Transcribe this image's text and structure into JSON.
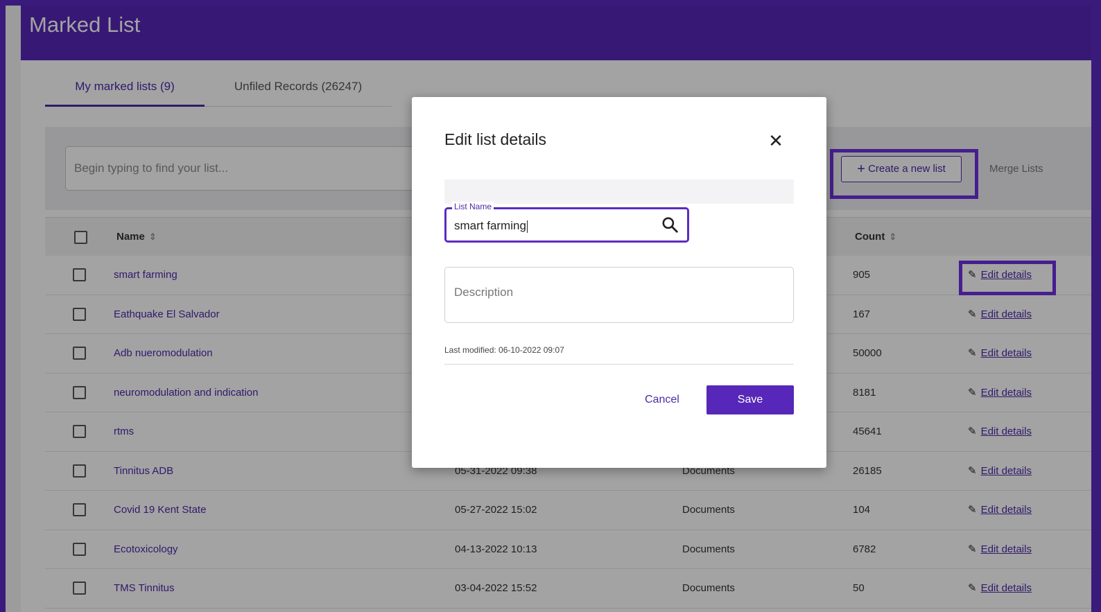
{
  "header": {
    "title": "Marked List"
  },
  "tabs": [
    {
      "label": "My marked lists (9)"
    },
    {
      "label": "Unfiled Records (26247)"
    }
  ],
  "toolbar": {
    "search_placeholder": "Begin typing to find your list...",
    "create_label": "Create a new list",
    "merge_label": "Merge Lists"
  },
  "table": {
    "columns": {
      "name": "Name",
      "count": "Count"
    },
    "rows": [
      {
        "name": "smart farming",
        "date": "",
        "type": "",
        "count": "905",
        "edit": "Edit details"
      },
      {
        "name": "Eathquake El Salvador",
        "date": "",
        "type": "",
        "count": "167",
        "edit": "Edit details"
      },
      {
        "name": "Adb nueromodulation",
        "date": "",
        "type": "",
        "count": "50000",
        "edit": "Edit details"
      },
      {
        "name": "neuromodulation and indication",
        "date": "",
        "type": "",
        "count": "8181",
        "edit": "Edit details"
      },
      {
        "name": "rtms",
        "date": "",
        "type": "",
        "count": "45641",
        "edit": "Edit details"
      },
      {
        "name": "Tinnitus ADB",
        "date": "05-31-2022 09:38",
        "type": "Documents",
        "count": "26185",
        "edit": "Edit details"
      },
      {
        "name": "Covid 19 Kent State",
        "date": "05-27-2022 15:02",
        "type": "Documents",
        "count": "104",
        "edit": "Edit details"
      },
      {
        "name": "Ecotoxicology",
        "date": "04-13-2022 10:13",
        "type": "Documents",
        "count": "6782",
        "edit": "Edit details"
      },
      {
        "name": "TMS Tinnitus",
        "date": "03-04-2022 15:52",
        "type": "Documents",
        "count": "50",
        "edit": "Edit details"
      }
    ]
  },
  "modal": {
    "title": "Edit list details",
    "list_name_label": "List Name",
    "list_name_value": "smart farming",
    "description_placeholder": "Description",
    "last_modified": "Last modified: 06-10-2022 09:07",
    "cancel_label": "Cancel",
    "save_label": "Save"
  },
  "colors": {
    "brand": "#5627b8",
    "highlight": "#6e2fe0",
    "link": "#4b2aa8"
  }
}
